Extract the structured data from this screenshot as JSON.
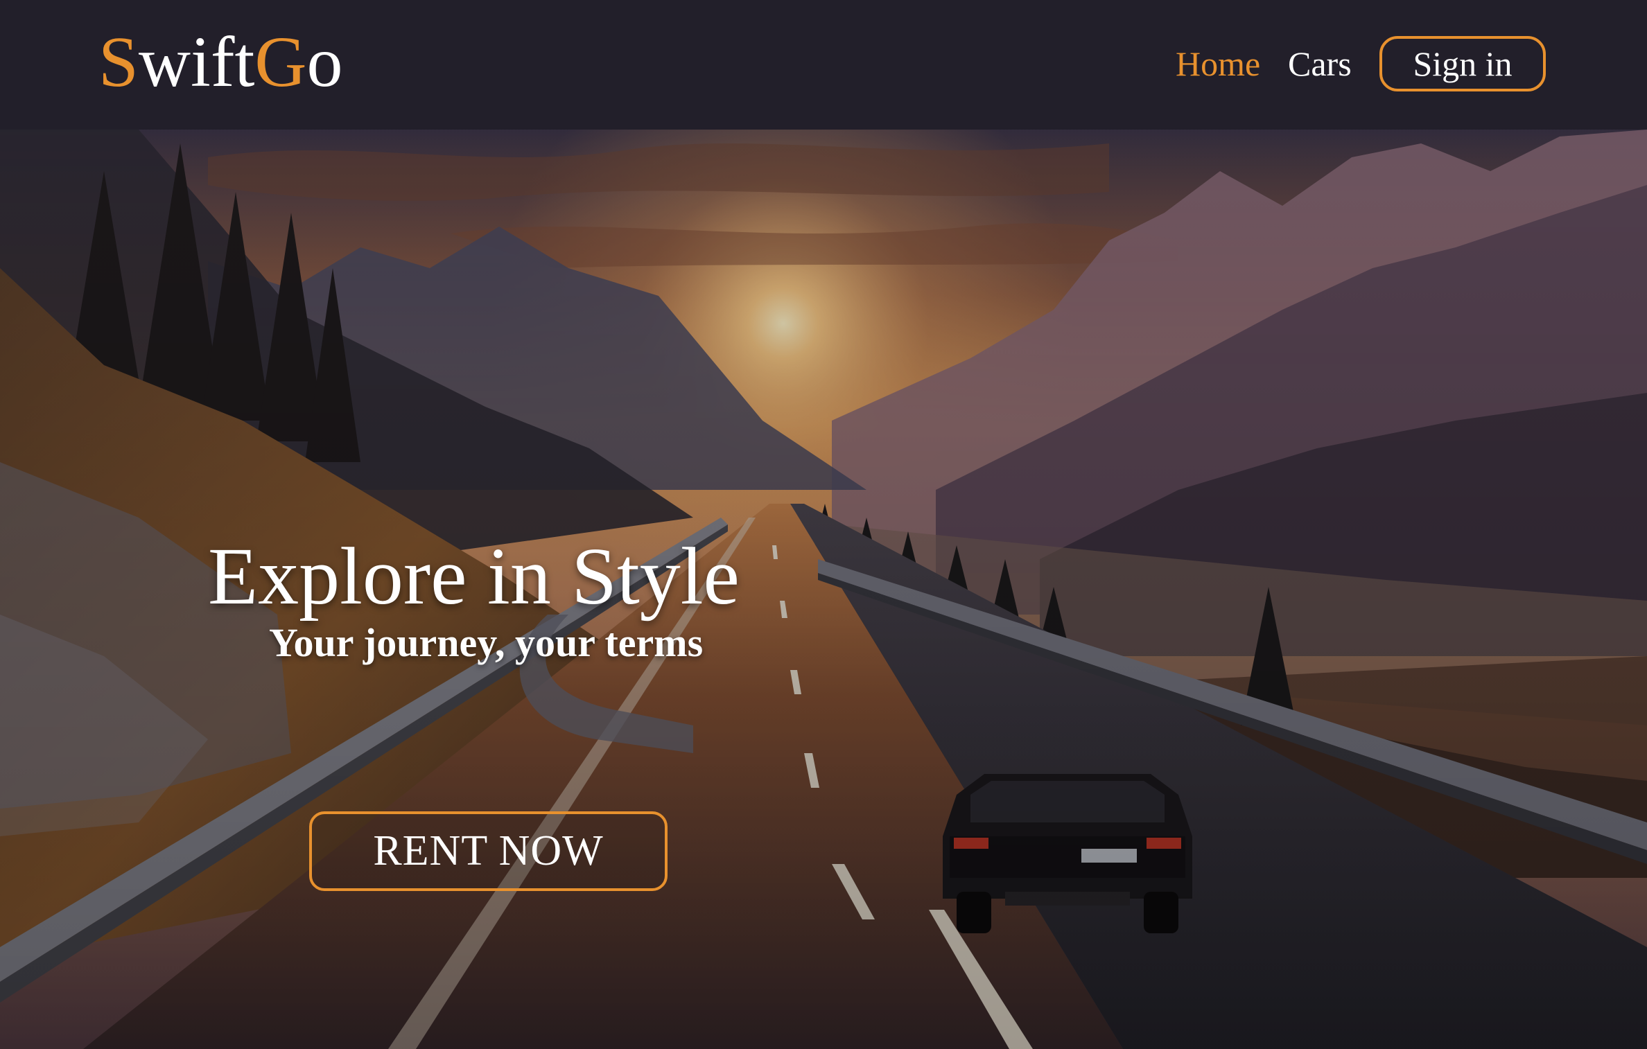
{
  "brand": {
    "logo_s": "S",
    "logo_wift": "wift",
    "logo_g": "G",
    "logo_o": "o",
    "accent_color": "#e8912e"
  },
  "nav": {
    "home_label": "Home",
    "cars_label": "Cars",
    "signin_label": "Sign in"
  },
  "hero": {
    "title": "Explore in Style",
    "subtitle": "Your journey, your terms",
    "cta_label": "RENT NOW",
    "image_description_icon": "mountain-road-sunset-image"
  },
  "colors": {
    "navbar_bg": "#221f2a",
    "text": "#ffffff"
  }
}
